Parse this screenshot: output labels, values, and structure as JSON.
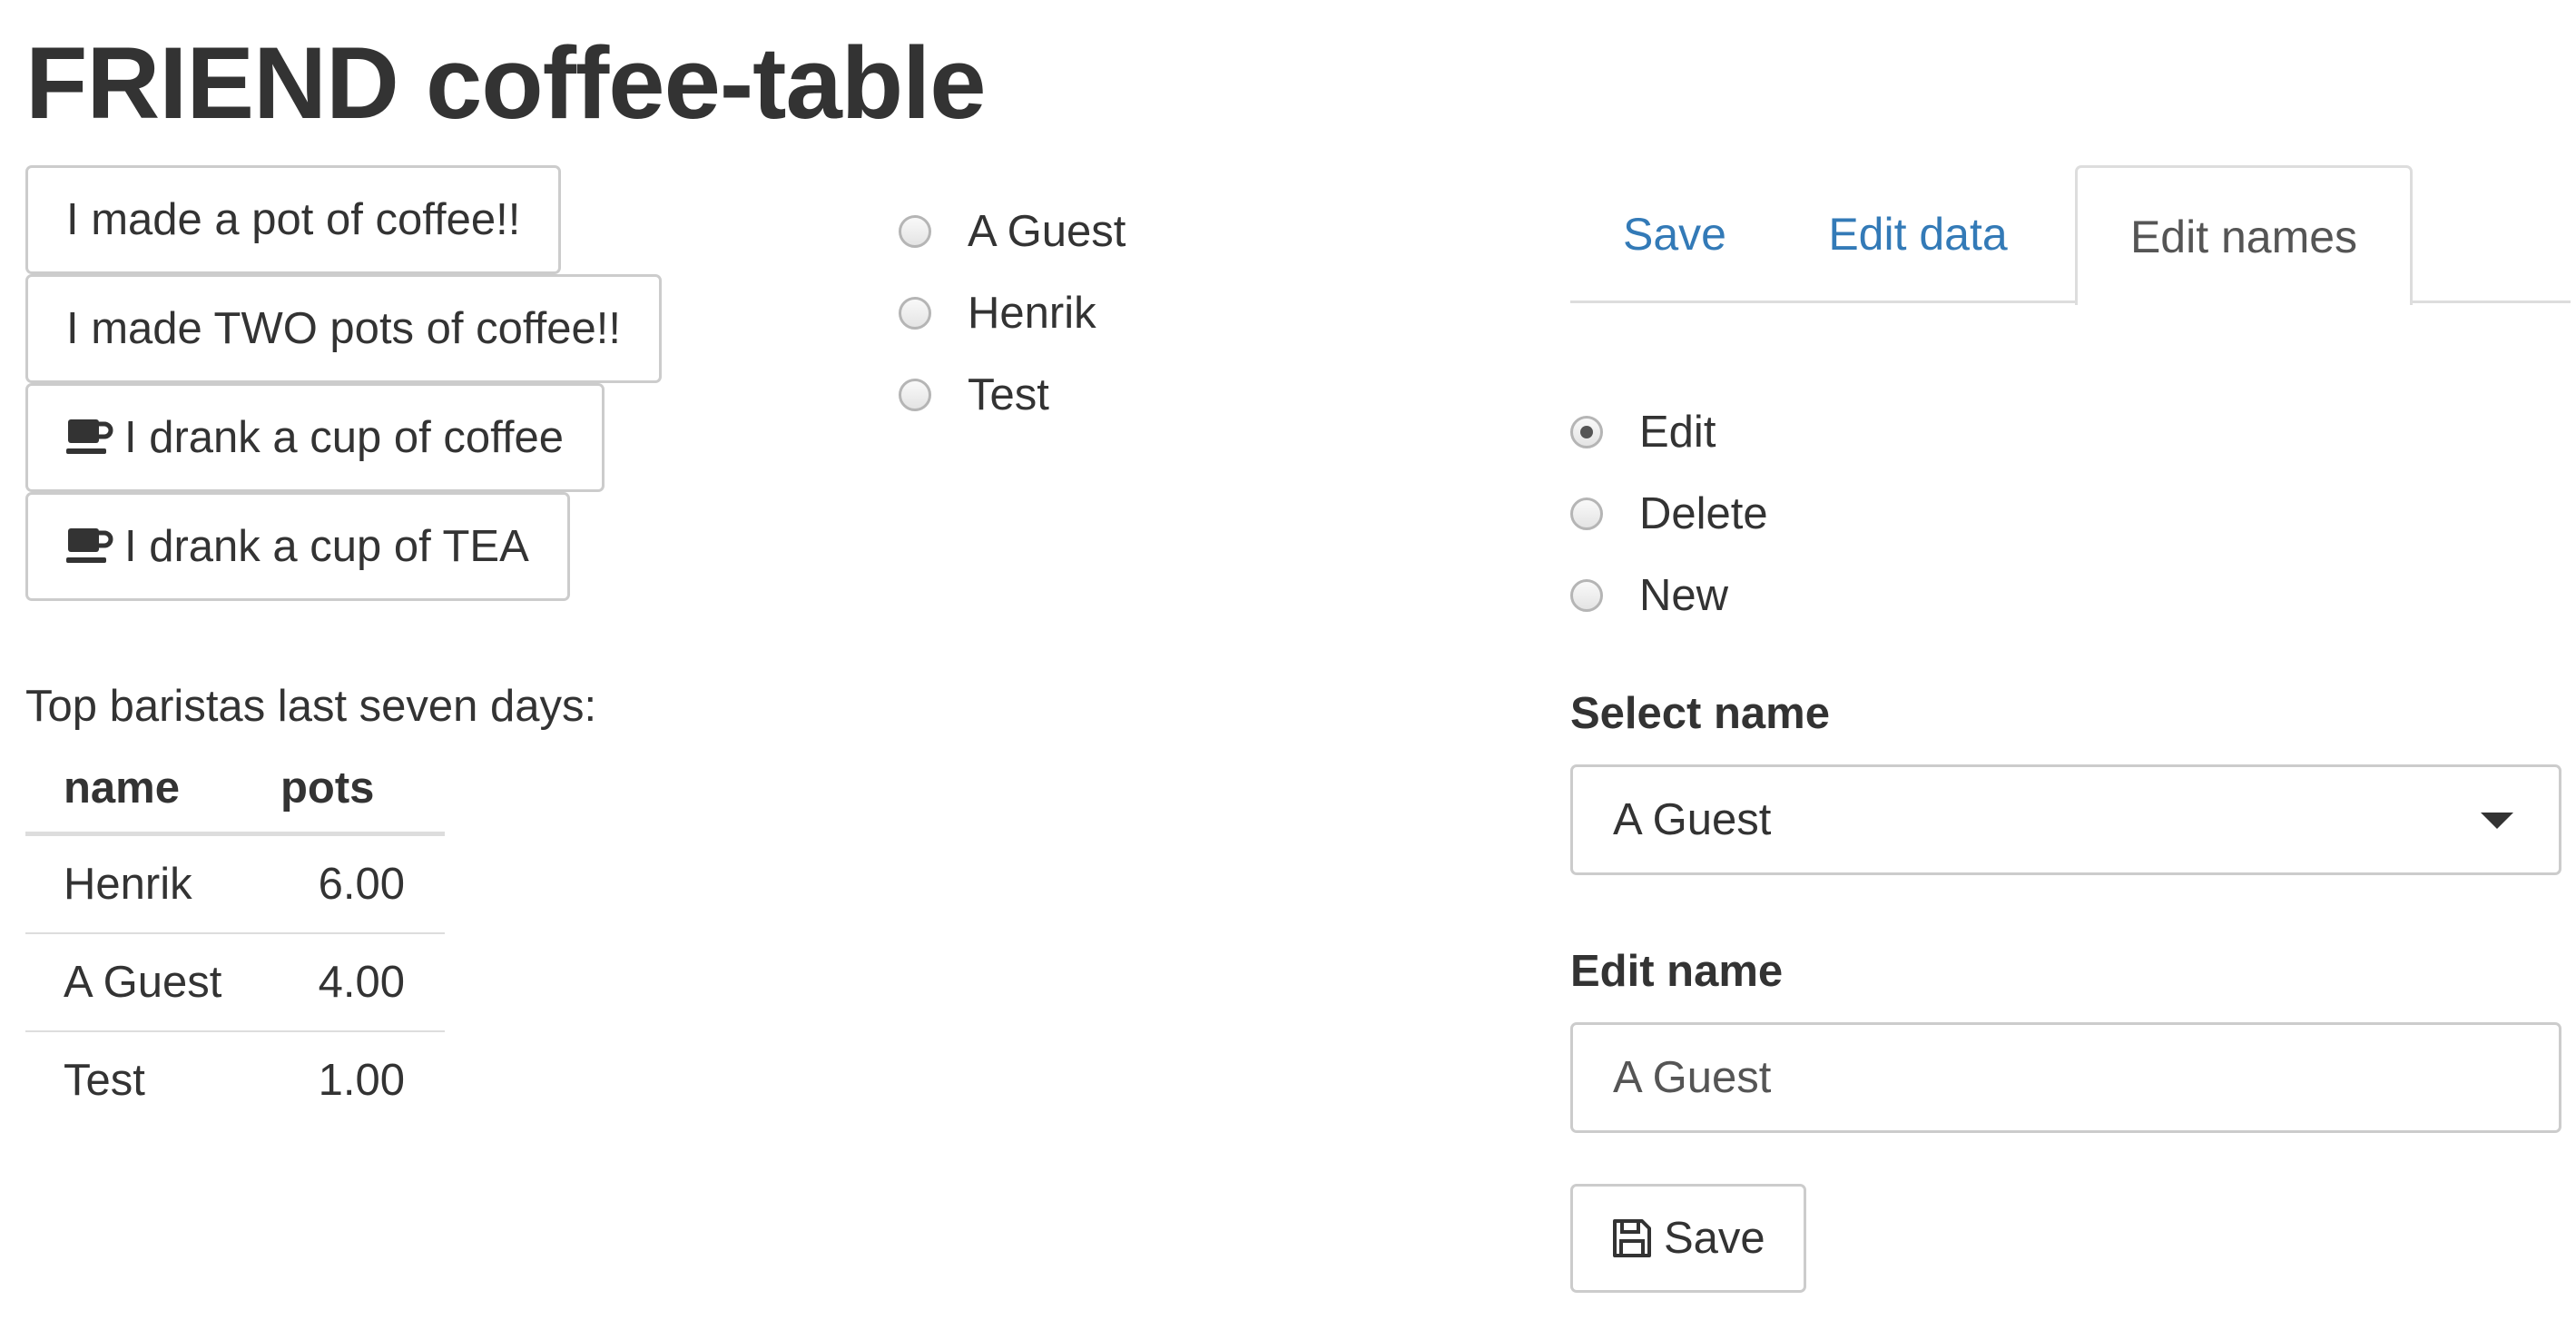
{
  "title": "FRIEND coffee-table",
  "actions": [
    {
      "label": "I made a pot of coffee!!",
      "icon": null
    },
    {
      "label": "I made TWO pots of coffee!!",
      "icon": null
    },
    {
      "label": "I drank a cup of coffee",
      "icon": "coffee-cup-icon"
    },
    {
      "label": "I drank a cup of TEA",
      "icon": "coffee-cup-icon"
    }
  ],
  "people": {
    "options": [
      "A Guest",
      "Henrik",
      "Test"
    ],
    "selected": null
  },
  "baristas": {
    "heading": "Top baristas last seven days:",
    "columns": [
      "name",
      "pots"
    ],
    "rows": [
      {
        "name": "Henrik",
        "pots": "6.00"
      },
      {
        "name": "A Guest",
        "pots": "4.00"
      },
      {
        "name": "Test",
        "pots": "1.00"
      }
    ]
  },
  "tabs": {
    "items": [
      "Save",
      "Edit data",
      "Edit names"
    ],
    "active": "Edit names"
  },
  "edit_names": {
    "mode_options": [
      "Edit",
      "Delete",
      "New"
    ],
    "mode_selected": "Edit",
    "select_label": "Select name",
    "select_value": "A Guest",
    "edit_label": "Edit name",
    "edit_value": "A Guest",
    "save_label": "Save",
    "save_icon": "floppy-disk-icon"
  },
  "colors": {
    "text": "#333333",
    "link": "#337ab7",
    "border": "#cccccc",
    "divider": "#dddddd"
  }
}
